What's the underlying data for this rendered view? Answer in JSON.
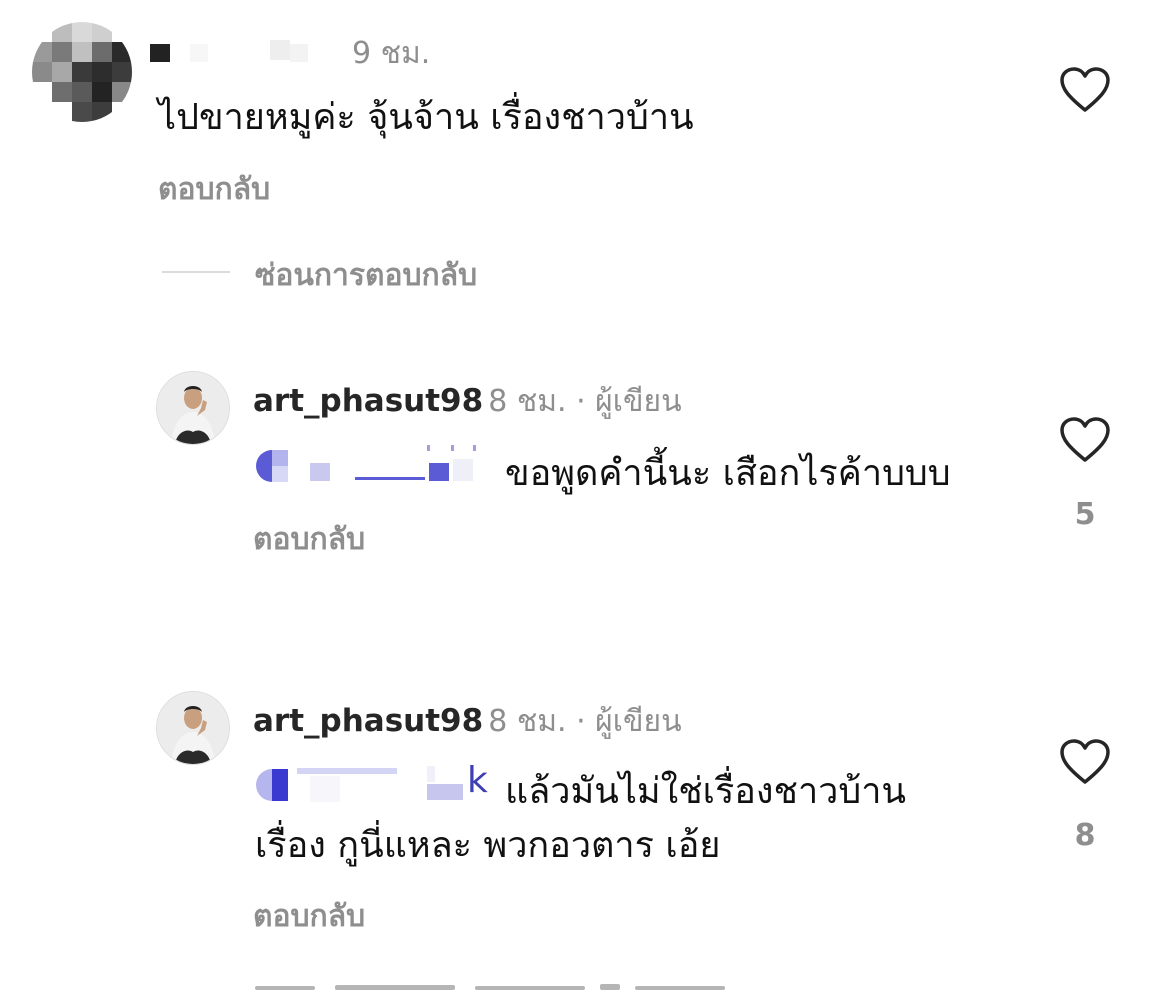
{
  "comments": [
    {
      "time": "9 ชม.",
      "text": "ไปขายหมูค่ะ  จุ้นจ้าน เรื่องชาวบ้าน",
      "reply_label": "ตอบกลับ"
    }
  ],
  "thread": {
    "hide_replies_label": "ซ่อนการตอบกลับ",
    "replies": [
      {
        "username": "art_phasut98",
        "meta": "8 ชม. · ผู้เขียน",
        "text": "ขอพูดคำนี้นะ เสือกไรค้าบบบ",
        "reply_label": "ตอบกลับ",
        "likes": "5"
      },
      {
        "username": "art_phasut98",
        "meta": "8 ชม. · ผู้เขียน",
        "mention_tail": "k",
        "text_line1": "แล้วมันไม่ใช่เรื่องชาวบ้าน",
        "text_line2": "เรื่อง กูนี่แหละ พวกอวตาร เอ้ย",
        "reply_label": "ตอบกลับ",
        "likes": "8"
      }
    ]
  },
  "colors": {
    "secondary_text": "#8e8e8e",
    "mention": "#3f3fb5"
  }
}
